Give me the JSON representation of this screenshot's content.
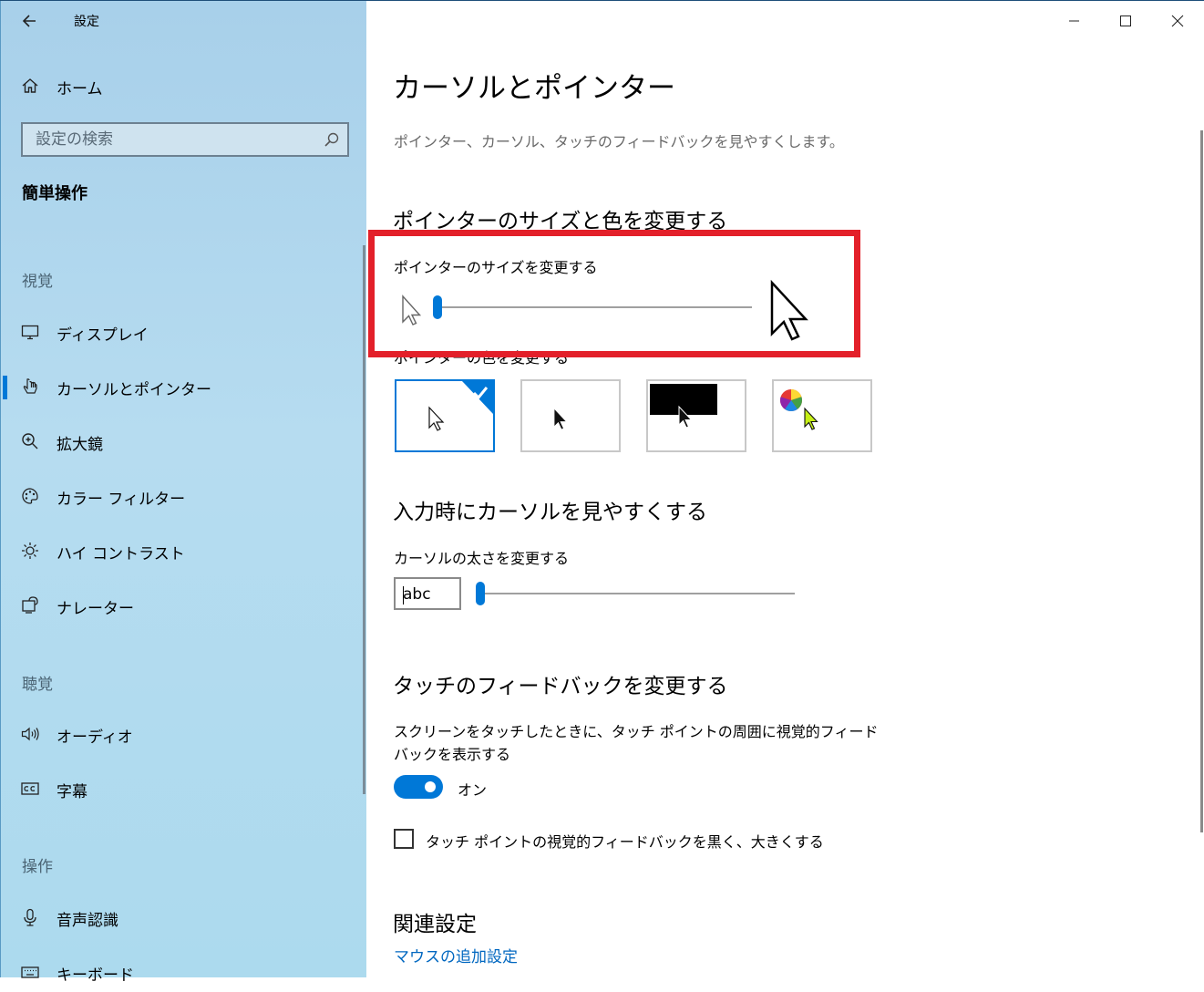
{
  "app": {
    "title": "設定"
  },
  "titlebar": {
    "minimize_icon": "minimize-icon",
    "maximize_icon": "maximize-icon",
    "close_icon": "close-icon"
  },
  "sidebar": {
    "home_label": "ホーム",
    "search": {
      "placeholder": "設定の検索",
      "value": ""
    },
    "category": "簡単操作",
    "sections": [
      {
        "heading": "視覚"
      },
      {
        "heading": "聴覚"
      },
      {
        "heading": "操作"
      }
    ],
    "items": [
      {
        "label": "ディスプレイ",
        "icon": "monitor-icon"
      },
      {
        "label": "カーソルとポインター",
        "icon": "pointer-hand-icon",
        "active": true
      },
      {
        "label": "拡大鏡",
        "icon": "magnifier-icon"
      },
      {
        "label": "カラー フィルター",
        "icon": "palette-icon"
      },
      {
        "label": "ハイ コントラスト",
        "icon": "brightness-icon"
      },
      {
        "label": "ナレーター",
        "icon": "narrator-icon"
      },
      {
        "label": "オーディオ",
        "icon": "speaker-icon"
      },
      {
        "label": "字幕",
        "icon": "cc-icon"
      },
      {
        "label": "音声認識",
        "icon": "microphone-icon"
      },
      {
        "label": "キーボード",
        "icon": "keyboard-icon"
      }
    ]
  },
  "main": {
    "title": "カーソルとポインター",
    "description": "ポインター、カーソル、タッチのフィードバックを見やすくします。",
    "pointer_section": {
      "heading": "ポインターのサイズと色を変更する",
      "size_label": "ポインターのサイズを変更する",
      "size_value": 1,
      "color_label": "ポインターの色を変更する",
      "color_options": [
        "white",
        "black",
        "inverted",
        "custom"
      ],
      "selected_color": "white"
    },
    "cursor_section": {
      "heading": "入力時にカーソルを見やすくする",
      "thickness_label": "カーソルの太さを変更する",
      "preview_text": "abc",
      "thickness_value": 1
    },
    "touch_section": {
      "heading": "タッチのフィードバックを変更する",
      "feedback_label": "スクリーンをタッチしたときに、タッチ ポイントの周囲に視覚的フィードバックを表示する",
      "toggle_state": "オン",
      "checkbox_label": "タッチ ポイントの視覚的フィードバックを黒く、大きくする",
      "checkbox_checked": false
    },
    "related": {
      "heading": "関連設定",
      "link": "マウスの追加設定"
    }
  },
  "colors": {
    "accent": "#0078d7",
    "highlight": "#e3202a",
    "link": "#0067c0"
  }
}
